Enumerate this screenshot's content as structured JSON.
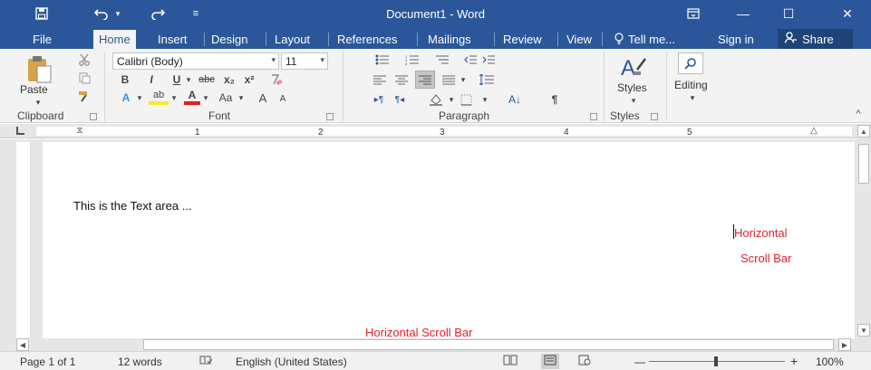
{
  "titlebar": {
    "title": "Document1 - Word",
    "save_icon": "save-icon",
    "undo_icon": "undo-icon",
    "redo_icon": "redo-icon",
    "customize_icon": "customize-quick-access-icon",
    "ribbon_options_icon": "ribbon-display-options-icon",
    "minimize_glyph": "—",
    "restore_glyph": "☐",
    "close_glyph": "✕"
  },
  "tabs": [
    {
      "label": "File"
    },
    {
      "label": "Home"
    },
    {
      "label": "Insert"
    },
    {
      "label": "Design"
    },
    {
      "label": "Layout"
    },
    {
      "label": "References"
    },
    {
      "label": "Mailings"
    },
    {
      "label": "Review"
    },
    {
      "label": "View"
    }
  ],
  "tellme": "Tell me...",
  "signin": "Sign in",
  "share": "Share",
  "ribbon": {
    "clipboard": {
      "label": "Clipboard",
      "paste": "Paste"
    },
    "font": {
      "label": "Font",
      "name": "Calibri (Body)",
      "size": "11",
      "bold": "B",
      "italic": "I",
      "underline": "U",
      "strike": "abc",
      "sub": "x₂",
      "sup": "x²",
      "text_effects": "A",
      "highlight": "ab",
      "font_color": "A",
      "change_case": "Aa",
      "grow": "A",
      "shrink": "A"
    },
    "paragraph": {
      "label": "Paragraph",
      "sort": "A↓",
      "pilcrow": "¶"
    },
    "styles": {
      "label": "Styles",
      "button": "Styles"
    },
    "editing": {
      "button": "Editing"
    }
  },
  "ruler": {
    "numbers": [
      "1",
      "2",
      "3",
      "4",
      "5"
    ]
  },
  "document": {
    "text": "This is the Text area ...",
    "annotation_right_1": "Horizontal",
    "annotation_right_2": "Scroll Bar",
    "annotation_bottom": "Horizontal Scroll Bar",
    "annotation_color": "#e8202a"
  },
  "status": {
    "page": "Page 1 of 1",
    "words": "12 words",
    "proofing_icon": "proofing-icon",
    "language": "English (United States)",
    "read_mode_icon": "read-mode-icon",
    "print_layout_icon": "print-layout-icon",
    "web_layout_icon": "web-layout-icon",
    "zoom_out": "—",
    "zoom_in": "+",
    "zoom": "100%",
    "zoom_level_percent": 100
  },
  "colors": {
    "brand": "#2b579a",
    "ribbon_bg": "#f3f3f3",
    "doc_bg": "#e6e6e6"
  }
}
